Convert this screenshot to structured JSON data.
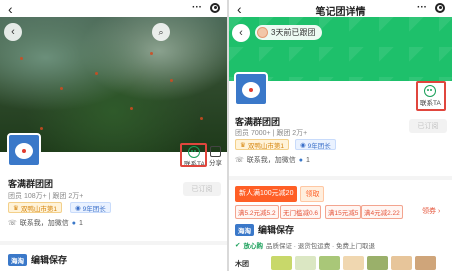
{
  "left": {
    "group_name": "客满群团团",
    "stats": "团员 108万+ | 跟团 2万+",
    "tag_rank": "双鸭山市第1",
    "tag_years": "9年团长",
    "contact_line": "联系我，加微信",
    "contact_count": "1",
    "subscribed_label": "已订阅",
    "contact_ta_label": "联系TA",
    "share_label": "分享",
    "post_badge": "海淘",
    "post_title": "编辑保存"
  },
  "right": {
    "page_title": "笔记团详情",
    "joined_notice": "3天前已跟团",
    "group_name": "客满群团团",
    "stats": "团员 7000+ | 跟团 2万+",
    "tag_rank": "双鸭山市第1",
    "tag_years": "9年团长",
    "contact_line": "联系我，加微信",
    "contact_count": "1",
    "subscribed_label": "已订阅",
    "contact_ta_label": "联系TA",
    "promo_new": "新人满100元减20",
    "promo_claim": "领取",
    "coupons": [
      "满5.2元减5.2",
      "无门槛减0.6",
      "满15元减5",
      "满4元减2.22"
    ],
    "more_label": "领券 ›",
    "post_badge": "海淘",
    "post_title": "编辑保存",
    "trust_label": "放心购",
    "trust_text": "品质保证 · 退货包运费 · 免费上门取退",
    "bottom_label": "木团"
  },
  "colors": {
    "brand_green": "#1ec06b",
    "highlight_red": "#e0463d",
    "promo_orange": "#ff5f26",
    "badge_blue": "#3a78c9"
  }
}
